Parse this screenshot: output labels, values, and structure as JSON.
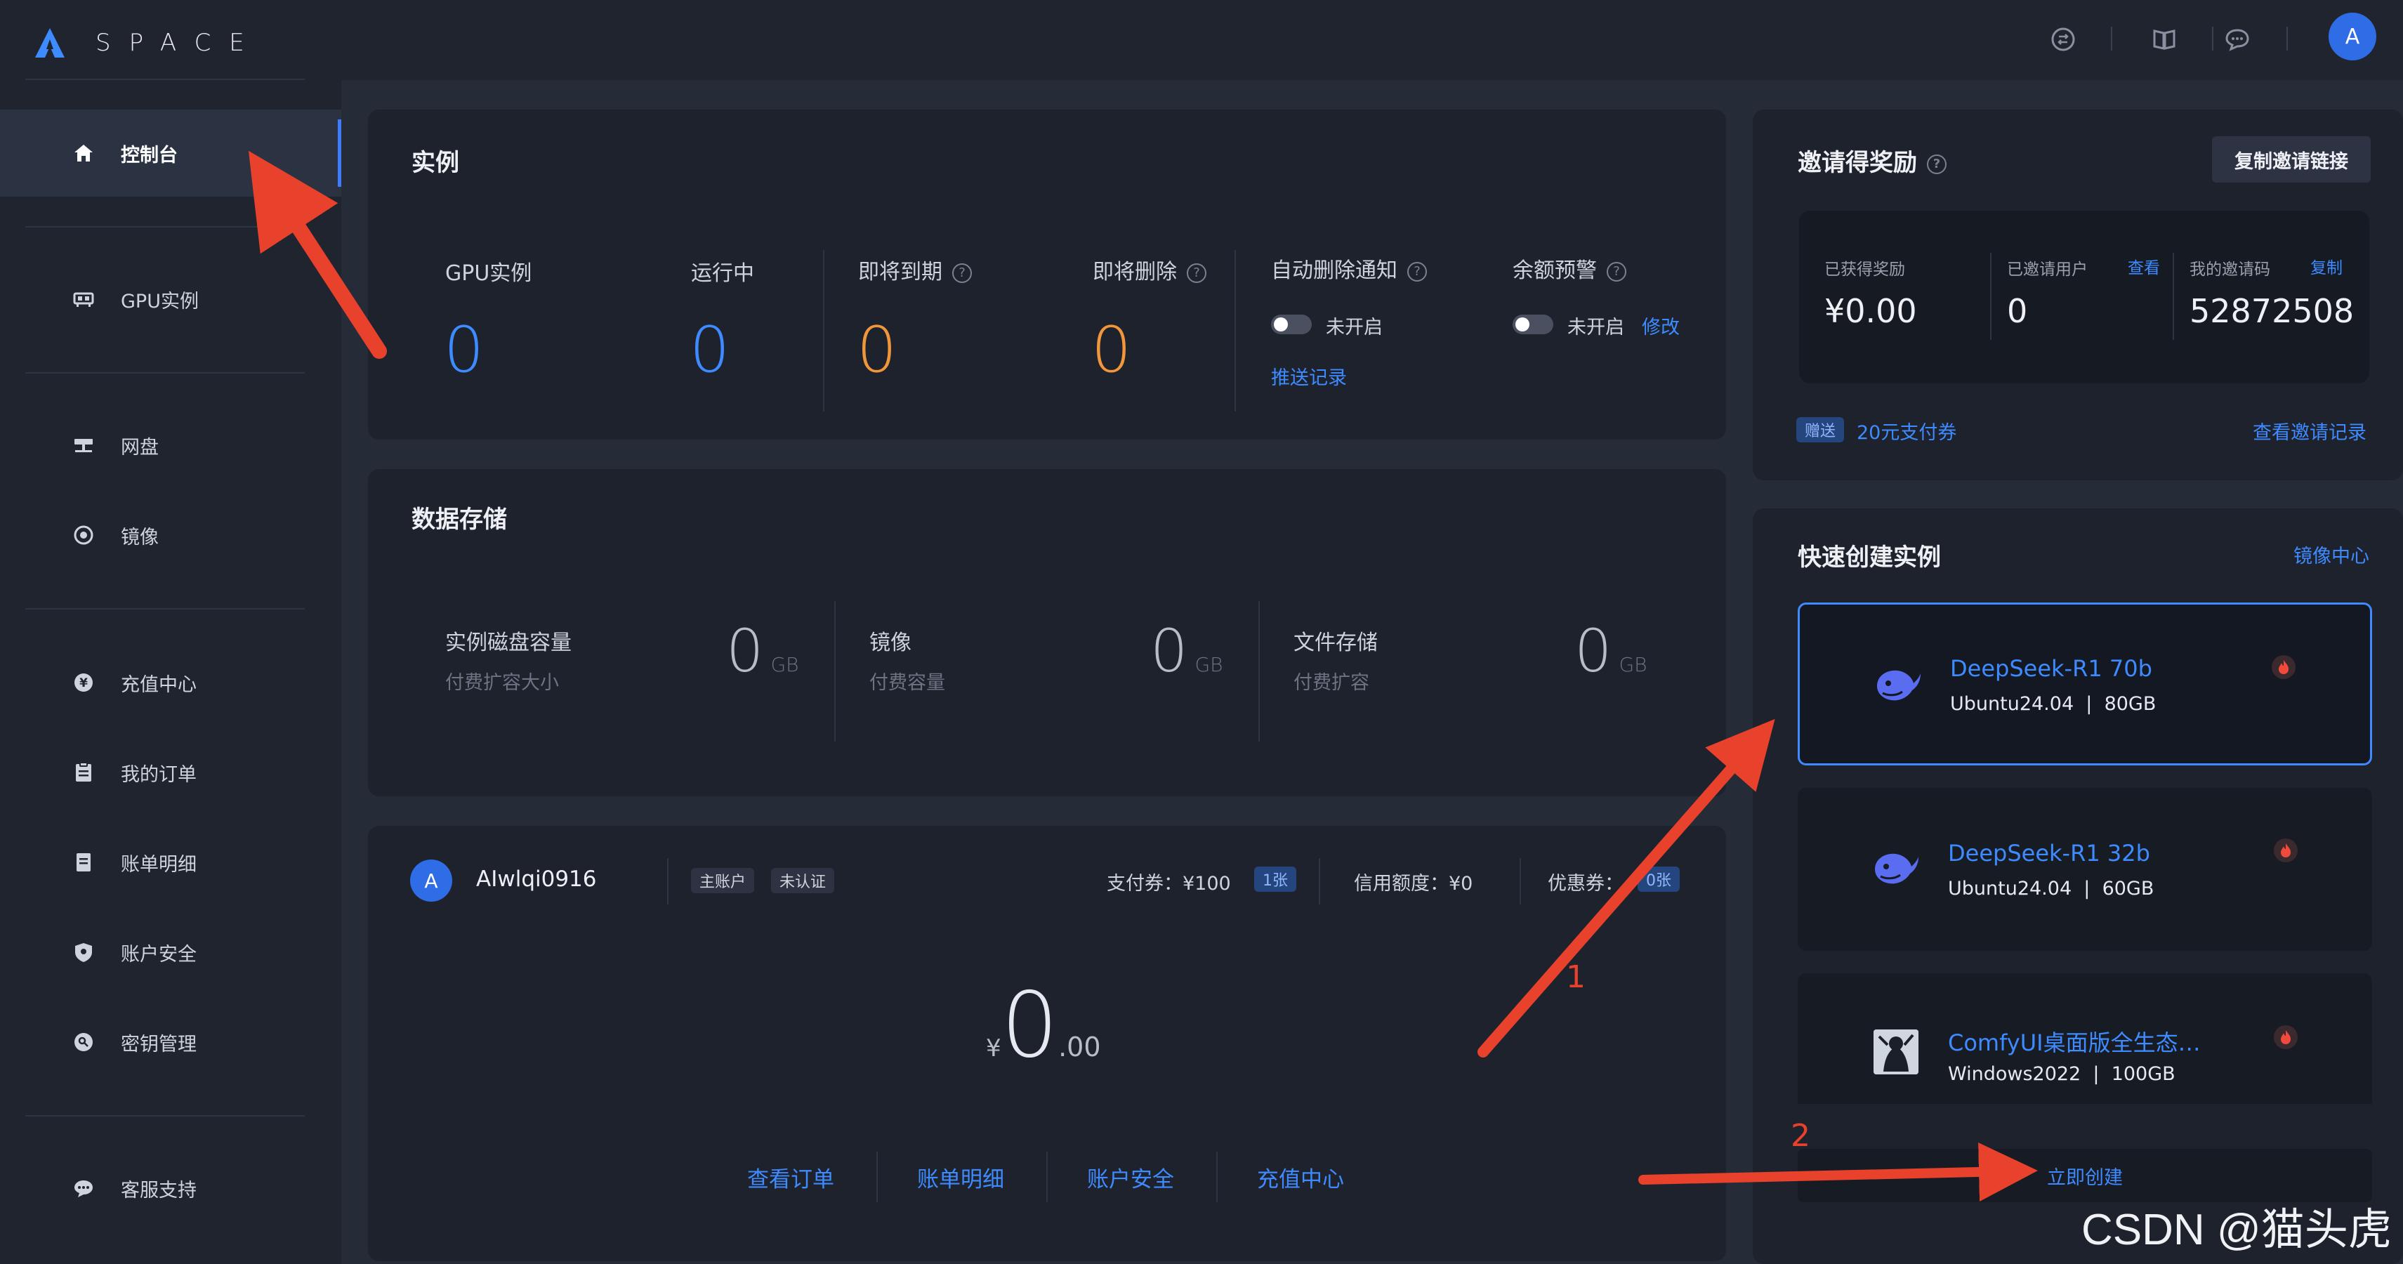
{
  "app": {
    "logo_text": "SPACE",
    "user_initial": "A"
  },
  "sidebar": {
    "items": [
      {
        "label": "控制台",
        "icon": "home-icon"
      },
      {
        "label": "GPU实例",
        "icon": "gpu-icon"
      },
      {
        "label": "网盘",
        "icon": "disk-icon"
      },
      {
        "label": "镜像",
        "icon": "image-icon"
      },
      {
        "label": "充值中心",
        "icon": "yen-icon"
      },
      {
        "label": "我的订单",
        "icon": "order-icon"
      },
      {
        "label": "账单明细",
        "icon": "bill-icon"
      },
      {
        "label": "账户安全",
        "icon": "shield-icon"
      },
      {
        "label": "密钥管理",
        "icon": "key-icon"
      },
      {
        "label": "客服支持",
        "icon": "chat-icon"
      }
    ]
  },
  "instances": {
    "title": "实例",
    "gpu_label": "GPU实例",
    "gpu_value": "0",
    "running_label": "运行中",
    "running_value": "0",
    "expiring_label": "即将到期",
    "expiring_value": "0",
    "deleting_label": "即将删除",
    "deleting_value": "0",
    "auto_delete_label": "自动删除通知",
    "auto_delete_status": "未开启",
    "push_record": "推送记录",
    "balance_alert_label": "余额预警",
    "balance_alert_status": "未开启",
    "modify": "修改"
  },
  "storage": {
    "title": "数据存储",
    "items": [
      {
        "label": "实例磁盘容量",
        "sub": "付费扩容大小",
        "value": "0",
        "unit": "GB"
      },
      {
        "label": "镜像",
        "sub": "付费容量",
        "value": "0",
        "unit": "GB"
      },
      {
        "label": "文件存储",
        "sub": "付费扩容",
        "value": "0",
        "unit": "GB"
      }
    ]
  },
  "account": {
    "avatar": "A",
    "username": "AIwlqi0916",
    "badge_main": "主账户",
    "badge_unverified": "未认证",
    "voucher_label": "支付券：",
    "voucher_value": "¥100",
    "voucher_count": "1张",
    "credit_label": "信用额度：",
    "credit_value": "¥0",
    "coupon_label": "优惠券：",
    "coupon_count": "0张",
    "currency": "¥",
    "balance_int": "0",
    "balance_dec": ".00",
    "links": [
      "查看订单",
      "账单明细",
      "账户安全",
      "充值中心"
    ]
  },
  "invite": {
    "title": "邀请得奖励",
    "copy_link_button": "复制邀请链接",
    "earned_label": "已获得奖励",
    "earned_value": "¥0.00",
    "invited_label": "已邀请用户",
    "view": "查看",
    "invited_value": "0",
    "code_label": "我的邀请码",
    "copy": "复制",
    "code_value": "52872508",
    "gift_badge": "赠送",
    "gift_text": "20元支付券",
    "records_link": "查看邀请记录"
  },
  "quick_create": {
    "title": "快速创建实例",
    "mirror_center": "镜像中心",
    "cards": [
      {
        "name": "DeepSeek-R1 70b",
        "os": "Ubuntu24.04",
        "disk": "80GB"
      },
      {
        "name": "DeepSeek-R1 32b",
        "os": "Ubuntu24.04",
        "disk": "60GB"
      },
      {
        "name": "ComfyUI桌面版全生态…",
        "os": "Windows2022",
        "disk": "100GB"
      }
    ],
    "create_button": "立即创建"
  },
  "annotations": {
    "step1": "1",
    "step2": "2",
    "watermark": "CSDN @猫头虎"
  },
  "colors": {
    "accent": "#3e8bff",
    "orange": "#f1963a",
    "arrow": "#e8412c"
  }
}
